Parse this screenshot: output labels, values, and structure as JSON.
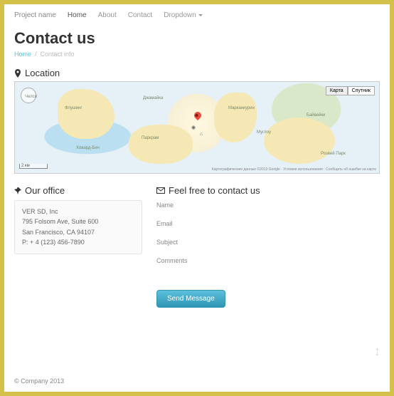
{
  "navbar": {
    "brand": "Project name",
    "items": [
      {
        "label": "Home"
      },
      {
        "label": "About"
      },
      {
        "label": "Contact"
      },
      {
        "label": "Dropdown"
      }
    ]
  },
  "page_title": "Contact us",
  "breadcrumb": {
    "home": "Home",
    "current": "Contact info"
  },
  "location": {
    "heading": "Location"
  },
  "map": {
    "btn_map": "Карта",
    "btn_sat": "Спутник",
    "scale": "2 км",
    "attribution": "Картографические данные ©2013 Google · Условия использования · Сообщить об ошибке на карте",
    "labels": {
      "l1": "Флушинг",
      "l2": "Ховард-Бич",
      "l3": "Джамайка",
      "l4": "Челси",
      "l5": "Марканкурин",
      "l6": "Муглоу",
      "l7": "Байвейки",
      "l8": "Паркрам",
      "l9": "Розвей Парк"
    }
  },
  "office": {
    "heading": "Our office",
    "name": "VER SD, Inc",
    "address1": "795 Folsom Ave, Suite 600",
    "address2": "San Francisco, CA 94107",
    "phone": "P: + 4 (123) 456-7890"
  },
  "contact_form": {
    "heading": "Feel free to contact us",
    "labels": {
      "name": "Name",
      "email": "Email",
      "subject": "Subject",
      "comments": "Comments"
    },
    "submit": "Send Message"
  },
  "footer": "© Company 2013"
}
